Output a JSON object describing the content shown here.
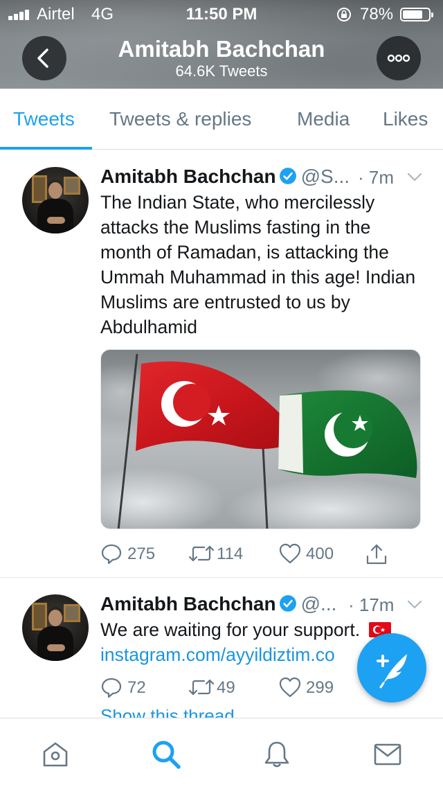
{
  "status_bar": {
    "carrier": "Airtel",
    "network": "4G",
    "time": "11:50 PM",
    "battery_percent": "78%",
    "battery_level": 0.78
  },
  "header": {
    "title": "Amitabh Bachchan",
    "subtitle": "64.6K Tweets",
    "back_icon": "chevron-left-icon",
    "more_icon": "more-dots-icon"
  },
  "tabs": [
    {
      "label": "Tweets",
      "active": true
    },
    {
      "label": "Tweets & replies",
      "active": false
    },
    {
      "label": "Media",
      "active": false
    },
    {
      "label": "Likes",
      "active": false
    }
  ],
  "tweets": [
    {
      "author": "Amitabh Bachchan",
      "handle": "@S...",
      "time": "· 7m",
      "text": "The Indian State, who mercilessly attacks the Muslims fasting in the month of Ramadan, is attacking the Ummah Muhammad in this age! Indian Muslims are entrusted to us by Abdulhamid",
      "replies": "275",
      "retweets": "114",
      "likes": "400"
    },
    {
      "author": "Amitabh Bachchan",
      "handle": "@...",
      "time": "· 17m",
      "text": "We are waiting for your support.",
      "link": "instagram.com/ayyildiztim.co",
      "replies": "72",
      "retweets": "49",
      "likes": "299"
    }
  ],
  "thread_link": "Show this thread",
  "bottom_nav": [
    {
      "icon": "home-icon",
      "active": false
    },
    {
      "icon": "search-icon",
      "active": true
    },
    {
      "icon": "bell-icon",
      "active": false
    },
    {
      "icon": "mail-icon",
      "active": false
    }
  ],
  "colors": {
    "accent": "#1da1f2",
    "link": "#1b95e0",
    "muted": "#657786",
    "text": "#14171a"
  }
}
